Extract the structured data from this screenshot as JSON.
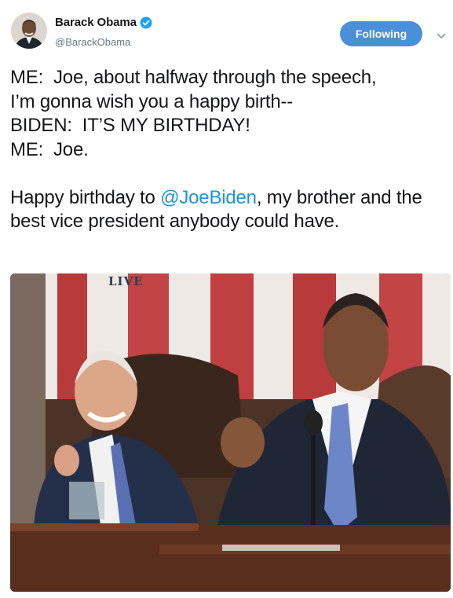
{
  "tweet": {
    "author": {
      "display_name": "Barack Obama",
      "handle": "@BarackObama",
      "verified": true
    },
    "follow_button_label": "Following",
    "text_lines": [
      "ME:  Joe, about halfway through the speech,",
      "I’m gonna wish you a happy birth--",
      "BIDEN:  IT’S MY BIRTHDAY!",
      "ME:  Joe."
    ],
    "text_p2_before": "Happy birthday to ",
    "text_p2_mention": "@JoeBiden",
    "text_p2_after": ", my brother and the best vice president anybody could have.",
    "media": {
      "overlay_label": "LIVE"
    }
  },
  "colors": {
    "accent": "#4a8fd8",
    "mention": "#1b95e0",
    "text": "#14171a",
    "secondary": "#657786"
  },
  "icons": {
    "verified": "verified-badge-icon",
    "caret": "chevron-down-icon"
  }
}
